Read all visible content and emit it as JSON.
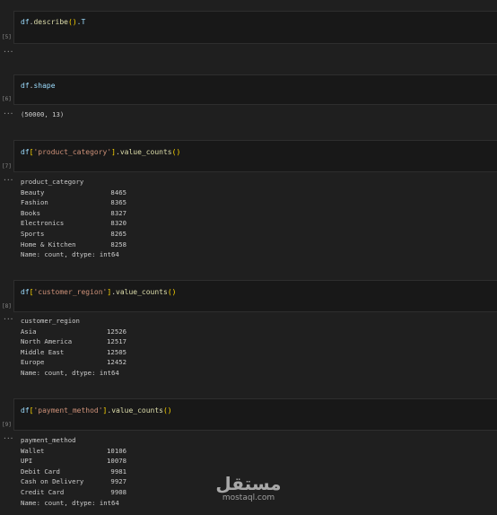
{
  "cells": [
    {
      "count": "[5]",
      "code": [
        {
          "t": "df",
          "c": "var"
        },
        {
          "t": ".",
          "c": "plain"
        },
        {
          "t": "describe",
          "c": "fn"
        },
        {
          "t": "()",
          "c": "punc"
        },
        {
          "t": ".T",
          "c": "var"
        }
      ],
      "output_dots": "···",
      "output_text": null
    },
    {
      "count": "[6]",
      "code": [
        {
          "t": "df",
          "c": "var"
        },
        {
          "t": ".",
          "c": "plain"
        },
        {
          "t": "shape",
          "c": "var"
        }
      ],
      "output_dots": "···",
      "output_text": "(50000, 13)"
    },
    {
      "count": "[7]",
      "code": [
        {
          "t": "df",
          "c": "var"
        },
        {
          "t": "[",
          "c": "punc"
        },
        {
          "t": "'product_category'",
          "c": "str"
        },
        {
          "t": "]",
          "c": "punc"
        },
        {
          "t": ".",
          "c": "plain"
        },
        {
          "t": "value_counts",
          "c": "fn"
        },
        {
          "t": "()",
          "c": "punc"
        }
      ],
      "output_dots": "···",
      "output_header": "product_category",
      "output_rows": [
        {
          "name": "Beauty",
          "value": "8465"
        },
        {
          "name": "Fashion",
          "value": "8365"
        },
        {
          "name": "Books",
          "value": "8327"
        },
        {
          "name": "Electronics",
          "value": "8320"
        },
        {
          "name": "Sports",
          "value": "8265"
        },
        {
          "name": "Home & Kitchen",
          "value": "8258"
        }
      ],
      "output_footer": "Name: count, dtype: int64"
    },
    {
      "count": "[8]",
      "code": [
        {
          "t": "df",
          "c": "var"
        },
        {
          "t": "[",
          "c": "punc"
        },
        {
          "t": "'customer_region'",
          "c": "str"
        },
        {
          "t": "]",
          "c": "punc"
        },
        {
          "t": ".",
          "c": "plain"
        },
        {
          "t": "value_counts",
          "c": "fn"
        },
        {
          "t": "()",
          "c": "punc"
        }
      ],
      "output_dots": "···",
      "output_header": "customer_region",
      "output_rows": [
        {
          "name": "Asia",
          "value": "12526"
        },
        {
          "name": "North America",
          "value": "12517"
        },
        {
          "name": "Middle East",
          "value": "12505"
        },
        {
          "name": "Europe",
          "value": "12452"
        }
      ],
      "output_footer": "Name: count, dtype: int64"
    },
    {
      "count": "[9]",
      "code": [
        {
          "t": "df",
          "c": "var"
        },
        {
          "t": "[",
          "c": "punc"
        },
        {
          "t": "'payment_method'",
          "c": "str"
        },
        {
          "t": "]",
          "c": "punc"
        },
        {
          "t": ".",
          "c": "plain"
        },
        {
          "t": "value_counts",
          "c": "fn"
        },
        {
          "t": "()",
          "c": "punc"
        }
      ],
      "output_dots": "···",
      "output_header": "payment_method",
      "output_rows": [
        {
          "name": "Wallet",
          "value": "10106"
        },
        {
          "name": "UPI",
          "value": "10078"
        },
        {
          "name": "Debit Card",
          "value": "9981"
        },
        {
          "name": "Cash on Delivery",
          "value": "9927"
        },
        {
          "name": "Credit Card",
          "value": "9908"
        }
      ],
      "output_footer": "Name: count, dtype: int64"
    }
  ],
  "watermark": {
    "arabic": "مستقل",
    "latin": "mostaql.com"
  }
}
